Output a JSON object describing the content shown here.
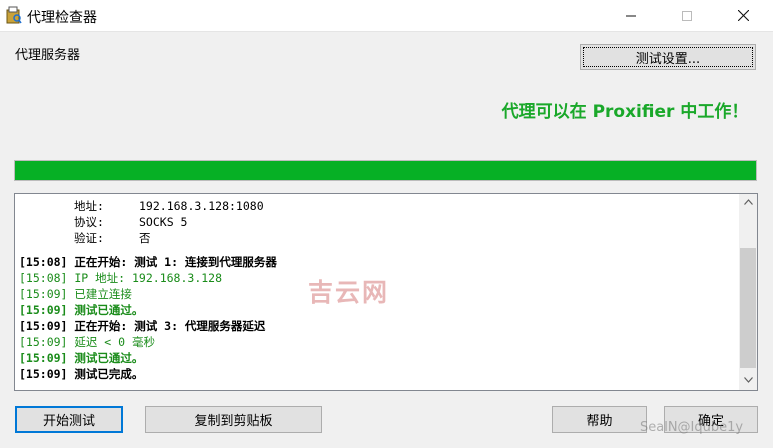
{
  "window": {
    "title": "代理检查器"
  },
  "section_label": "代理服务器",
  "settings_button": "测试设置...",
  "status_message": "代理可以在 Proxifier 中工作！",
  "progress_fraction": 1.0,
  "details": [
    {
      "key": "地址:",
      "value": "192.168.3.128:1080"
    },
    {
      "key": "协议:",
      "value": "SOCKS 5"
    },
    {
      "key": "验证:",
      "value": "否"
    }
  ],
  "log": [
    {
      "text": "[15:08] 正在开始: 测试 1: 连接到代理服务器",
      "style": "bold"
    },
    {
      "text": "[15:08] IP 地址: 192.168.3.128",
      "style": "green"
    },
    {
      "text": "[15:09] 已建立连接",
      "style": "green"
    },
    {
      "text": "[15:09] 测试已通过。",
      "style": "green bold"
    },
    {
      "text": "[15:09] 正在开始: 测试 3: 代理服务器延迟",
      "style": "bold"
    },
    {
      "text": "[15:09] 延迟 < 0 毫秒",
      "style": "green"
    },
    {
      "text": "[15:09] 测试已通过。",
      "style": "green bold"
    },
    {
      "text": "[15:09] 测试已完成。",
      "style": "bold"
    }
  ],
  "buttons": {
    "start": "开始测试",
    "copy": "复制到剪贴板",
    "help": "帮助",
    "ok": "确定"
  },
  "watermark": "吉云网",
  "corner_watermark": "SealN@Iqube1y",
  "colors": {
    "success_green": "#1aa82a",
    "progress_green": "#06b025",
    "log_green": "#1a8c1a"
  }
}
